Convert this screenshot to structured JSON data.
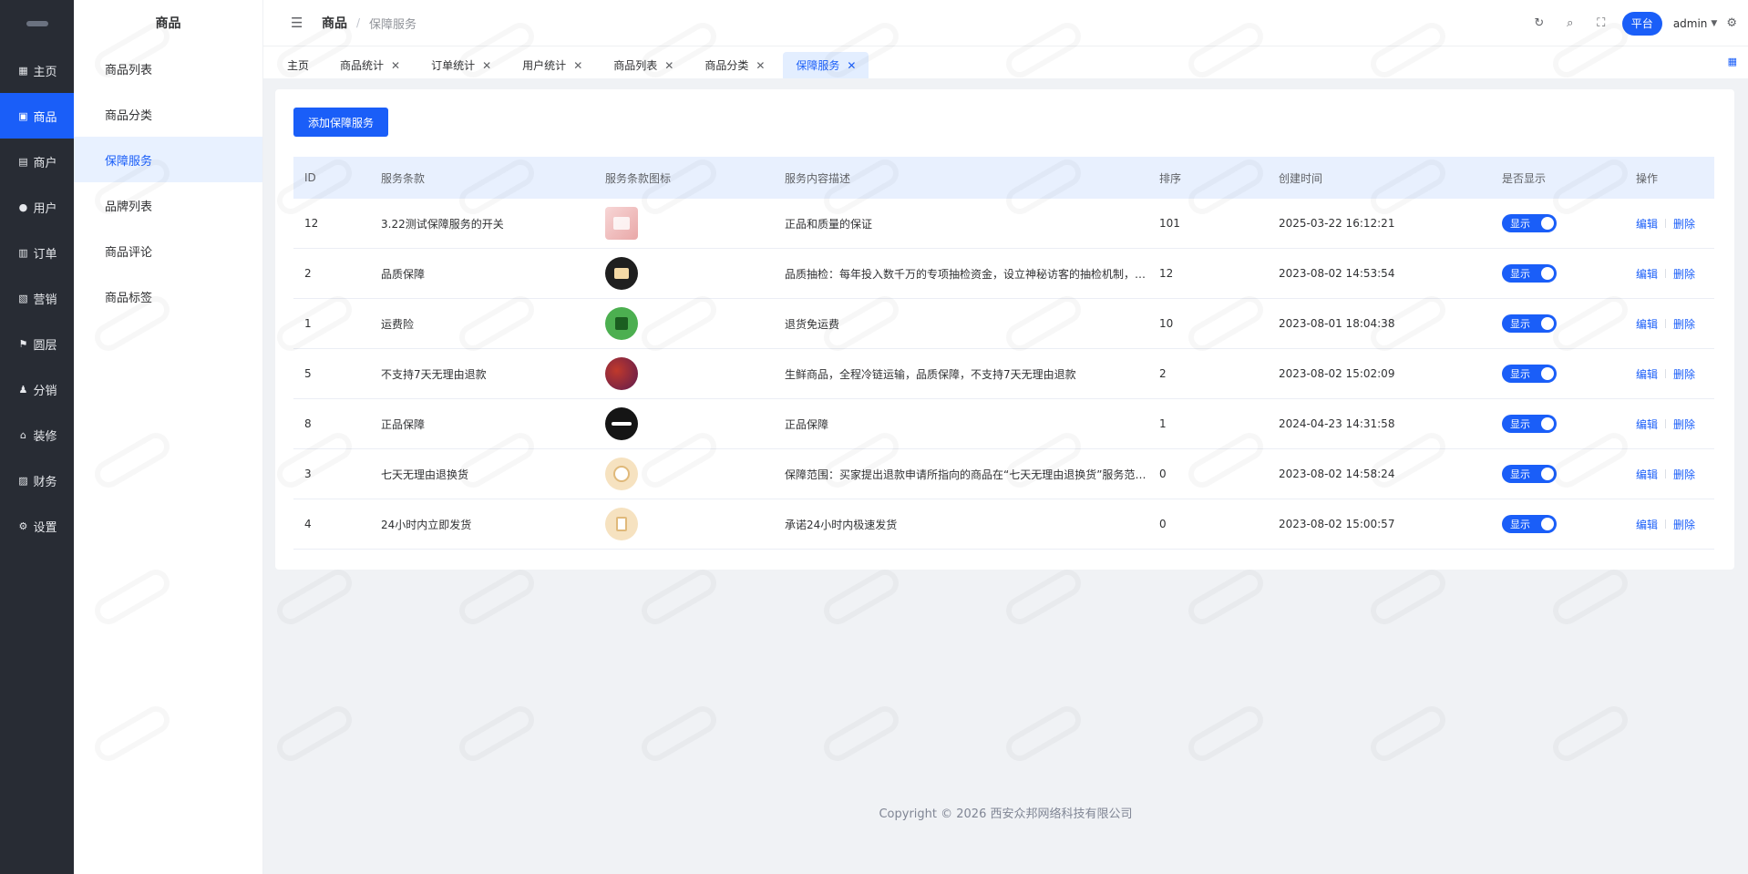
{
  "rail": {
    "items": [
      {
        "label": "主页",
        "icon": "grid-icon"
      },
      {
        "label": "商品",
        "icon": "bag-icon",
        "active": true
      },
      {
        "label": "商户",
        "icon": "store-icon"
      },
      {
        "label": "用户",
        "icon": "user-icon"
      },
      {
        "label": "订单",
        "icon": "clipboard-icon"
      },
      {
        "label": "营销",
        "icon": "chart-icon"
      },
      {
        "label": "圆层",
        "icon": "flag-icon"
      },
      {
        "label": "分销",
        "icon": "person-icon"
      },
      {
        "label": "装修",
        "icon": "home-icon"
      },
      {
        "label": "财务",
        "icon": "wallet-icon"
      },
      {
        "label": "设置",
        "icon": "gear-icon"
      }
    ]
  },
  "submenu": {
    "title": "商品",
    "items": [
      "商品列表",
      "商品分类",
      "保障服务",
      "品牌列表",
      "商品评论",
      "商品标签"
    ],
    "active_index": 2
  },
  "header": {
    "crumb1": "商品",
    "separator": "/",
    "crumb2": "保障服务",
    "platform_label": "平台",
    "user_name": "admin"
  },
  "tabs": [
    {
      "label": "主页",
      "closable": false
    },
    {
      "label": "商品统计",
      "closable": true
    },
    {
      "label": "订单统计",
      "closable": true
    },
    {
      "label": "用户统计",
      "closable": true
    },
    {
      "label": "商品列表",
      "closable": true
    },
    {
      "label": "商品分类",
      "closable": true
    },
    {
      "label": "保障服务",
      "closable": true,
      "active": true
    }
  ],
  "toolbar": {
    "add_label": "添加保障服务"
  },
  "table": {
    "headers": [
      "ID",
      "服务条款",
      "服务条款图标",
      "服务内容描述",
      "排序",
      "创建时间",
      "是否显示",
      "操作"
    ],
    "rows": [
      {
        "id": "12",
        "name": "3.22测试保障服务的开关",
        "icon": "photo-thumb",
        "desc": "正品和质量的保证",
        "sort": "101",
        "created": "2025-03-22 16:12:21",
        "show": "显示"
      },
      {
        "id": "2",
        "name": "品质保障",
        "icon": "quality-badge",
        "desc": "品质抽检：每年投入数千万的专项抽检资金，设立神秘访客的抽检机制，支持消费者随时对商品质量进行监督",
        "sort": "12",
        "created": "2023-08-02 14:53:54",
        "show": "显示"
      },
      {
        "id": "1",
        "name": "运费险",
        "icon": "shipping-bag",
        "desc": "退货免运费",
        "sort": "10",
        "created": "2023-08-01 18:04:38",
        "show": "显示"
      },
      {
        "id": "5",
        "name": "不支持7天无理由退款",
        "icon": "fruit-photo",
        "desc": "生鲜商品，全程冷链运输，品质保障，不支持7天无理由退款",
        "sort": "2",
        "created": "2023-08-02 15:02:09",
        "show": "显示"
      },
      {
        "id": "8",
        "name": "正品保障",
        "icon": "crmeb-logo",
        "desc": "正品保障",
        "sort": "1",
        "created": "2024-04-23 14:31:58",
        "show": "显示"
      },
      {
        "id": "3",
        "name": "七天无理由退换货",
        "icon": "return-badge",
        "desc": "保障范围：买家提出退款申请所指向的商品在“七天无理由退换货”服务范围内，且商品完好",
        "sort": "0",
        "created": "2023-08-02 14:58:24",
        "show": "显示"
      },
      {
        "id": "4",
        "name": "24小时内立即发货",
        "icon": "delivery-badge",
        "desc": "承诺24小时内极速发货",
        "sort": "0",
        "created": "2023-08-02 15:00:57",
        "show": "显示"
      }
    ],
    "edit_label": "编辑",
    "delete_label": "删除"
  },
  "footer": {
    "copyright": "Copyright © 2026 西安众邦网络科技有限公司"
  },
  "colors": {
    "primary": "#1a5ef8",
    "rail_bg": "#282c34",
    "header_row_bg": "#e8f0fe"
  }
}
